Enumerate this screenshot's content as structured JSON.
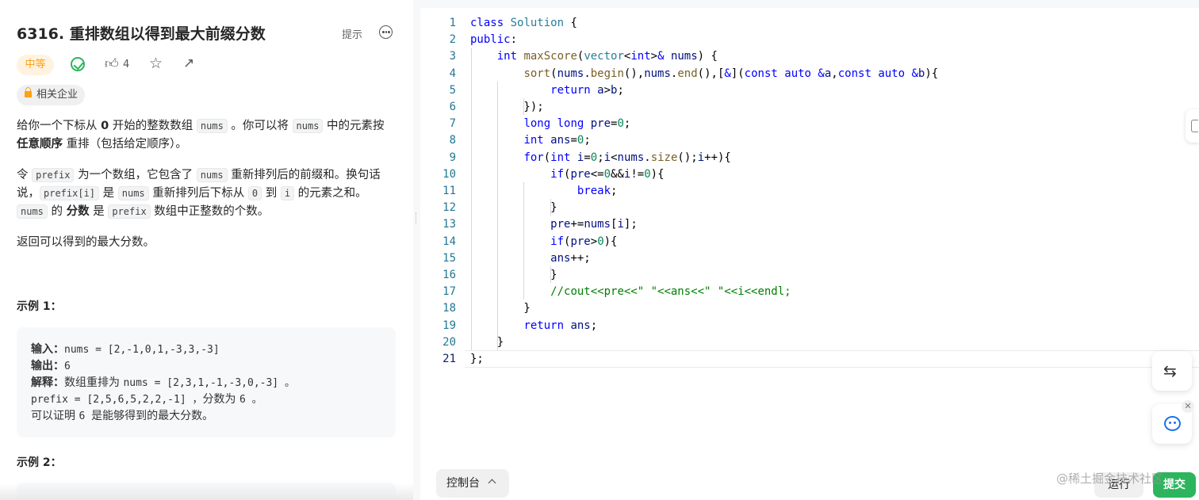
{
  "problem": {
    "title": "6316. 重排数组以得到最大前缀分数",
    "hint_label": "提示",
    "difficulty": "中等",
    "like_count": "4",
    "company_tag": "相关企业"
  },
  "description": {
    "p1_a": "给你一个下标从 ",
    "p1_b": "0",
    "p1_c": " 开始的整数数组 ",
    "p1_d": "nums",
    "p1_e": " 。你可以将 ",
    "p1_f": "nums",
    "p1_g": " 中的元素按 ",
    "p1_h": "任意顺序",
    "p1_i": " 重排（包括给定顺序）。",
    "p2_a": "令 ",
    "p2_b": "prefix",
    "p2_c": " 为一个数组，它包含了 ",
    "p2_d": "nums",
    "p2_e": " 重新排列后的前缀和。换句话说，",
    "p2_f": "prefix[i]",
    "p2_g": " 是 ",
    "p2_h": "nums",
    "p2_i": " 重新排列后下标从 ",
    "p2_j": "0",
    "p2_k": " 到 ",
    "p2_l": "i",
    "p2_m": " 的元素之和。",
    "p2_n": "nums",
    "p2_o": " 的 ",
    "p2_p": "分数",
    "p2_q": " 是 ",
    "p2_r": "prefix",
    "p2_s": " 数组中正整数的个数。",
    "p3": "返回可以得到的最大分数。"
  },
  "example1": {
    "title": "示例 1：",
    "input_label": "输入：",
    "input_value": "nums = [2,-1,0,1,-3,3,-3]",
    "output_label": "输出：",
    "output_value": "6",
    "explain_label": "解释：",
    "explain_line1_a": "数组重排为 ",
    "explain_line1_b": "nums = [2,3,1,-1,-3,0,-3] 。",
    "explain_line2_a": "prefix = [2,5,6,5,2,2,-1] ，",
    "explain_line2_b": "分数为 ",
    "explain_line2_c": "6 。",
    "explain_line3_a": "可以证明 ",
    "explain_line3_b": "6 ",
    "explain_line3_c": "是能够得到的最大分数。"
  },
  "example2": {
    "title": "示例 2："
  },
  "editor": {
    "line_numbers": [
      "1",
      "2",
      "3",
      "4",
      "5",
      "6",
      "7",
      "8",
      "9",
      "10",
      "11",
      "12",
      "13",
      "14",
      "15",
      "16",
      "17",
      "18",
      "19",
      "20",
      "21"
    ],
    "current_line": "21"
  },
  "bottom": {
    "console_label": "控制台",
    "run_label": "运行",
    "submit_label": "提交",
    "watermark": "@稀土掘金技术社区"
  },
  "colors": {
    "accent_green": "#2db55d",
    "difficulty_orange": "#ffa116"
  }
}
